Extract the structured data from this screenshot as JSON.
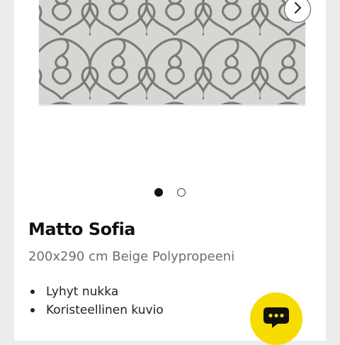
{
  "product": {
    "title": "Matto Sofia",
    "subtitle": "200x290 cm Beige Polypropeeni",
    "features": [
      "Lyhyt nukka",
      "Koristeellinen kuvio"
    ]
  },
  "gallery": {
    "image_count": 2,
    "active_index": 0
  },
  "icons": {
    "next": "chevron-right-icon",
    "chat": "chat-bubble-icon"
  },
  "colors": {
    "accent": "#f6dc00",
    "rug": "#d8d6d3",
    "pattern": "#6a6a6a"
  }
}
